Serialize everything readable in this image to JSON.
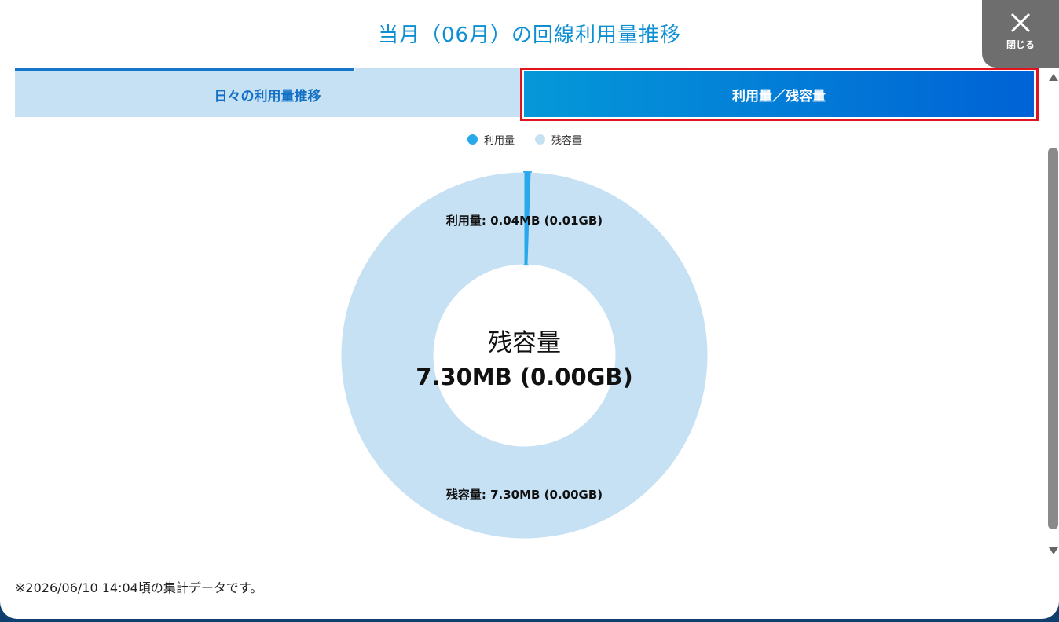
{
  "modal": {
    "title": "当月（06月）の回線利用量推移",
    "close_label": "閉じる",
    "footnote": "※2026/06/10 14:04頃の集計データです。"
  },
  "tabs": [
    {
      "label": "日々の利用量推移",
      "active": false
    },
    {
      "label": "利用量／残容量",
      "active": true
    }
  ],
  "chart_data": {
    "type": "pie",
    "legend": [
      "利用量",
      "残容量"
    ],
    "legend_position": "top",
    "slices": [
      {
        "name": "利用量",
        "value": 0.04,
        "label": "利用量: 0.04MB (0.01GB)",
        "color": "#29a8ec"
      },
      {
        "name": "残容量",
        "value": 7.3,
        "label": "残容量: 7.30MB (0.00GB)",
        "color": "#c6e1f4"
      }
    ],
    "center_title": "残容量",
    "center_value": "7.30MB (0.00GB)"
  },
  "colors": {
    "accent": "#0e8fd4",
    "highlight_border": "#e0141e"
  }
}
